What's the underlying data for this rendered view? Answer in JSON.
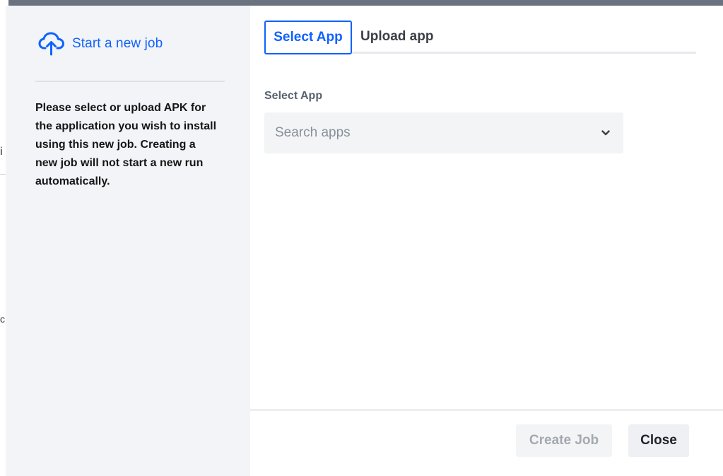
{
  "background": {
    "fragment_1": "i",
    "fragment_2": "c"
  },
  "sidebar": {
    "title": "Start a new job",
    "icon": "cloud-upload-icon",
    "description": "Please select or upload APK for the application you wish to install using this new job. Creating a new job will not start a new run automatically."
  },
  "tabs": [
    {
      "label": "Select App",
      "active": true
    },
    {
      "label": "Upload app",
      "active": false
    }
  ],
  "form": {
    "label": "Select App",
    "placeholder": "Search apps"
  },
  "footer": {
    "create_label": "Create Job",
    "create_disabled": true,
    "close_label": "Close"
  },
  "colors": {
    "accent": "#0f62fe",
    "sidebar_bg": "#f2f4f8",
    "overlay": "#6b7280"
  }
}
